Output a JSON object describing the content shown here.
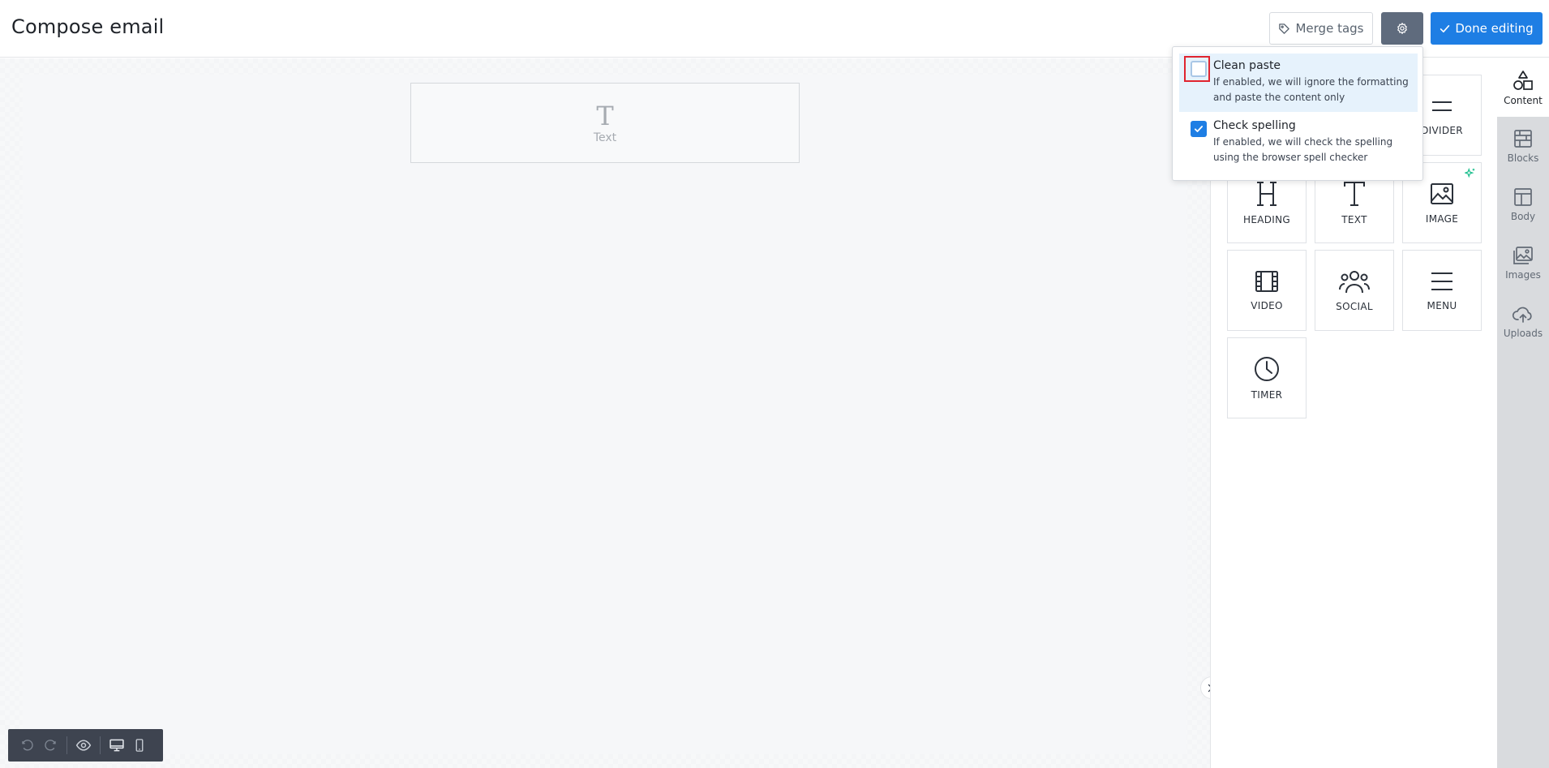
{
  "header": {
    "title": "Compose email",
    "merge_tags_label": "Merge tags",
    "done_label": "Done editing"
  },
  "canvas": {
    "text_block_label": "Text"
  },
  "settings_menu": {
    "options": [
      {
        "title": "Clean paste",
        "description": "If enabled, we will ignore the formatting and paste the content only",
        "checked": false
      },
      {
        "title": "Check spelling",
        "description": "If enabled, we will check the spelling using the browser spell checker",
        "checked": true
      }
    ]
  },
  "content_tiles": [
    {
      "label": "DIVIDER",
      "icon": "divider-icon"
    },
    {
      "label": "HEADING",
      "icon": "heading-icon"
    },
    {
      "label": "TEXT",
      "icon": "text-icon"
    },
    {
      "label": "IMAGE",
      "icon": "image-icon"
    },
    {
      "label": "VIDEO",
      "icon": "video-icon"
    },
    {
      "label": "SOCIAL",
      "icon": "social-icon"
    },
    {
      "label": "MENU",
      "icon": "menu-icon"
    },
    {
      "label": "TIMER",
      "icon": "timer-icon"
    }
  ],
  "side_tabs": [
    {
      "label": "Content",
      "icon": "shapes-icon",
      "active": true
    },
    {
      "label": "Blocks",
      "icon": "blocks-icon",
      "active": false
    },
    {
      "label": "Body",
      "icon": "layout-icon",
      "active": false
    },
    {
      "label": "Images",
      "icon": "images-icon",
      "active": false
    },
    {
      "label": "Uploads",
      "icon": "cloud-upload-icon",
      "active": false
    }
  ],
  "colors": {
    "primary": "#1e7ee4",
    "gear_button": "#5f6b7d",
    "toolbar": "#3e4450",
    "focus_ring": "#e0242f",
    "sparkle": "#1fbf8f"
  }
}
